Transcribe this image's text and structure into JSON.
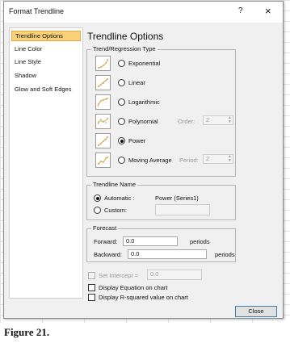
{
  "window": {
    "title": "Format Trendline",
    "help_glyph": "?",
    "close_glyph": "×"
  },
  "nav": {
    "items": [
      {
        "label": "Trendline Options"
      },
      {
        "label": "Line Color"
      },
      {
        "label": "Line Style"
      },
      {
        "label": "Shadow"
      },
      {
        "label": "Glow and Soft Edges"
      }
    ],
    "selected": "Trendline Options",
    "selected_color": "#f9d17a"
  },
  "panel": {
    "heading": "Trendline Options",
    "regression_group": "Trend/Regression Type",
    "types": [
      {
        "label": "Exponential",
        "icon": "exponential-chart-icon",
        "selected": false
      },
      {
        "label": "Linear",
        "icon": "linear-chart-icon",
        "selected": false
      },
      {
        "label": "Logarithmic",
        "icon": "logarithmic-chart-icon",
        "selected": false
      },
      {
        "label": "Polynomial",
        "icon": "polynomial-chart-icon",
        "selected": false
      },
      {
        "label": "Power",
        "icon": "power-chart-icon",
        "selected": true
      },
      {
        "label": "Moving Average",
        "icon": "moving-average-chart-icon",
        "selected": false
      }
    ],
    "order": {
      "label": "Order:",
      "value": "2"
    },
    "period": {
      "label": "Period:",
      "value": "2"
    },
    "name_group": "Trendline Name",
    "automatic": {
      "label": "Automatic :",
      "value": "Power (Series1)",
      "selected": true
    },
    "custom": {
      "label": "Custom:",
      "value": ""
    },
    "forecast_group": "Forecast",
    "forward": {
      "label": "Forward:",
      "value": "0.0",
      "unit": "periods"
    },
    "backward": {
      "label": "Backward:",
      "value": "0.0",
      "unit": "periods"
    },
    "intercept": {
      "label": "Set Intercept =",
      "value": "0.0",
      "checked": false
    },
    "display_equation": {
      "label": "Display Equation on chart",
      "checked": false
    },
    "display_r2": {
      "label": "Display R-squared value on chart",
      "checked": false
    }
  },
  "footer": {
    "close_label": "Close"
  },
  "caption": "Figure 21."
}
